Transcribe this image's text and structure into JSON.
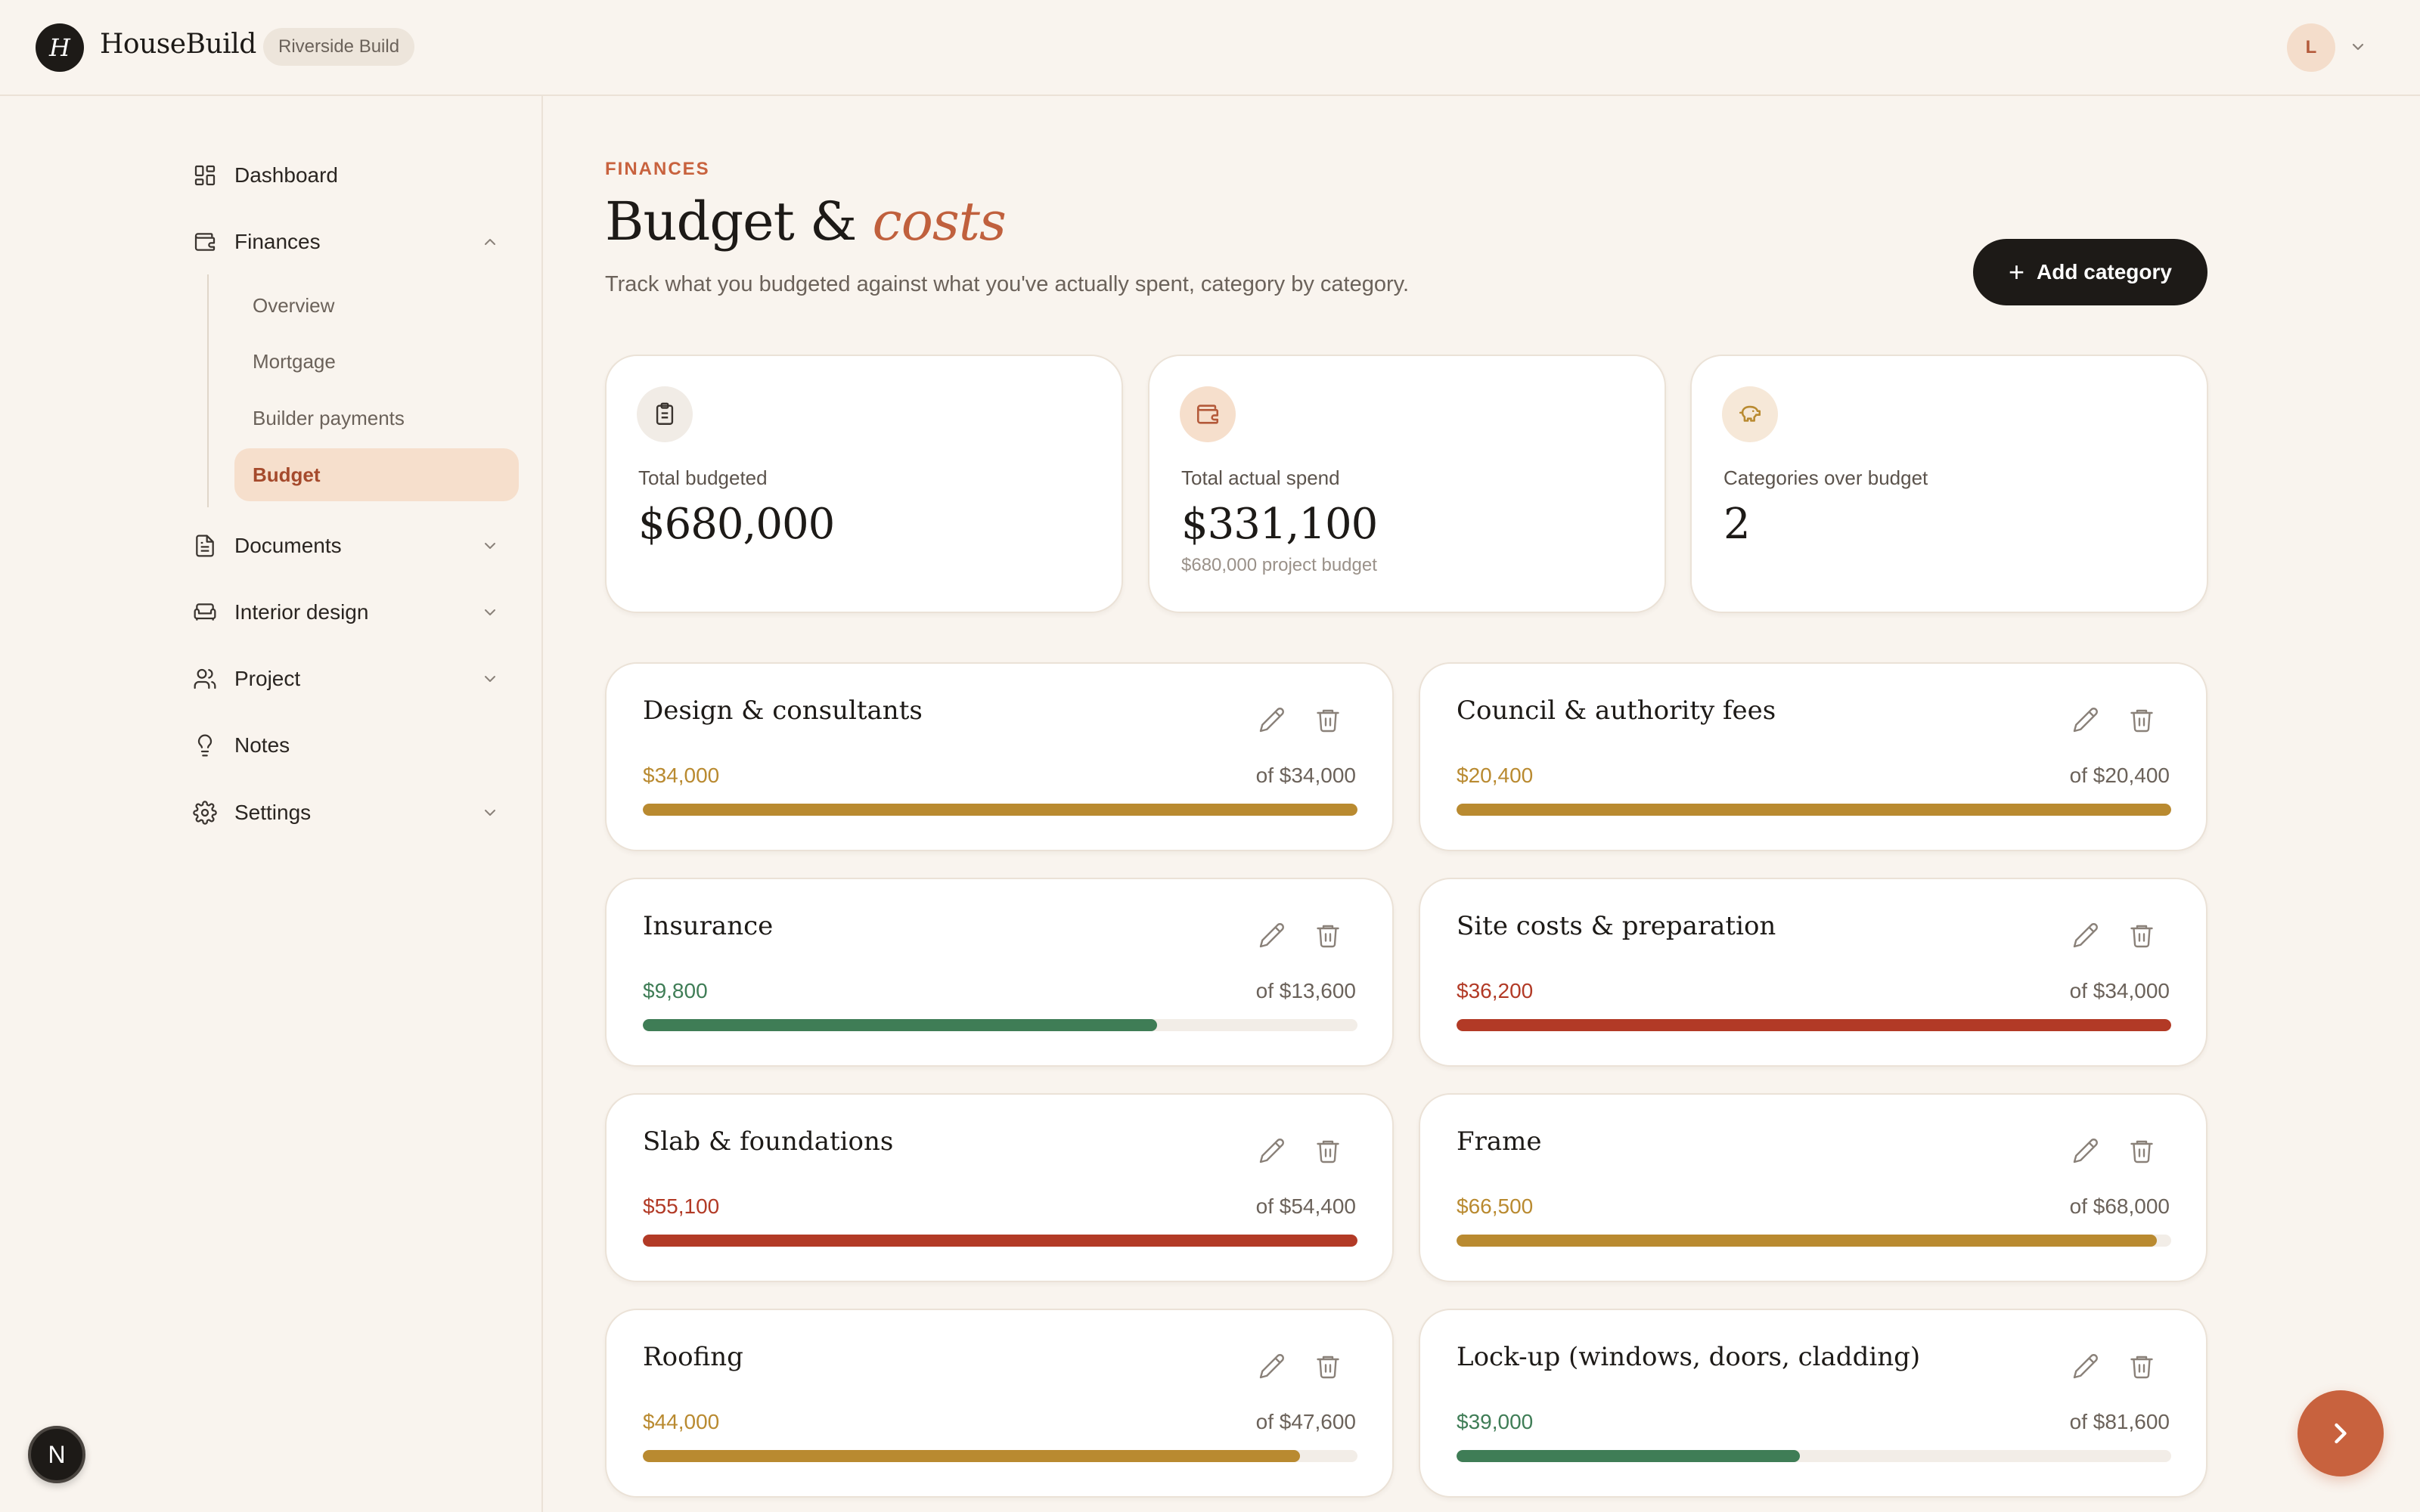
{
  "app": {
    "logo_letter": "H",
    "name": "HouseBuild",
    "project": "Riverside Build",
    "user_initial": "L"
  },
  "sidebar": {
    "items": [
      {
        "label": "Dashboard",
        "icon": "dashboard-icon"
      },
      {
        "label": "Finances",
        "icon": "wallet-icon",
        "expanded": true
      },
      {
        "label": "Documents",
        "icon": "document-icon"
      },
      {
        "label": "Interior design",
        "icon": "sofa-icon"
      },
      {
        "label": "Project",
        "icon": "users-icon"
      },
      {
        "label": "Notes",
        "icon": "lightbulb-icon"
      },
      {
        "label": "Settings",
        "icon": "gear-icon"
      }
    ],
    "finance_sub": [
      "Overview",
      "Mortgage",
      "Builder payments",
      "Budget"
    ],
    "active_sub": "Budget",
    "dev_button": "N"
  },
  "page": {
    "eyebrow": "FINANCES",
    "title_main": "Budget & ",
    "title_accent": "costs",
    "subtitle": "Track what you budgeted against what you've actually spent, category by category.",
    "add_button": "Add category"
  },
  "stats": [
    {
      "label": "Total budgeted",
      "value": "$680,000",
      "note": "",
      "icon": "clipboard-icon"
    },
    {
      "label": "Total actual spend",
      "value": "$331,100",
      "note": "$680,000 project budget",
      "icon": "wallet-icon"
    },
    {
      "label": "Categories over budget",
      "value": "2",
      "note": "",
      "icon": "piggy-bank-icon"
    }
  ],
  "categories": [
    {
      "name": "Design & consultants",
      "spent": "$34,000",
      "budget": "of $34,000",
      "progress": 1.0,
      "status": "at-budget"
    },
    {
      "name": "Council & authority fees",
      "spent": "$20,400",
      "budget": "of $20,400",
      "progress": 1.0,
      "status": "at-budget"
    },
    {
      "name": "Insurance",
      "spent": "$9,800",
      "budget": "of $13,600",
      "progress": 0.72,
      "status": "under"
    },
    {
      "name": "Site costs & preparation",
      "spent": "$36,200",
      "budget": "of $34,000",
      "progress": 1.0,
      "status": "over"
    },
    {
      "name": "Slab & foundations",
      "spent": "$55,100",
      "budget": "of $54,400",
      "progress": 1.0,
      "status": "over"
    },
    {
      "name": "Frame",
      "spent": "$66,500",
      "budget": "of $68,000",
      "progress": 0.98,
      "status": "at-budget"
    },
    {
      "name": "Roofing",
      "spent": "$44,000",
      "budget": "of $47,600",
      "progress": 0.92,
      "status": "at-budget"
    },
    {
      "name": "Lock-up (windows, doors, cladding)",
      "spent": "$39,000",
      "budget": "of $81,600",
      "progress": 0.48,
      "status": "under"
    }
  ],
  "colors": {
    "under": "#3f7d56",
    "at-budget": "#b98a30",
    "over": "#b23a26",
    "accent": "#c8623e"
  }
}
